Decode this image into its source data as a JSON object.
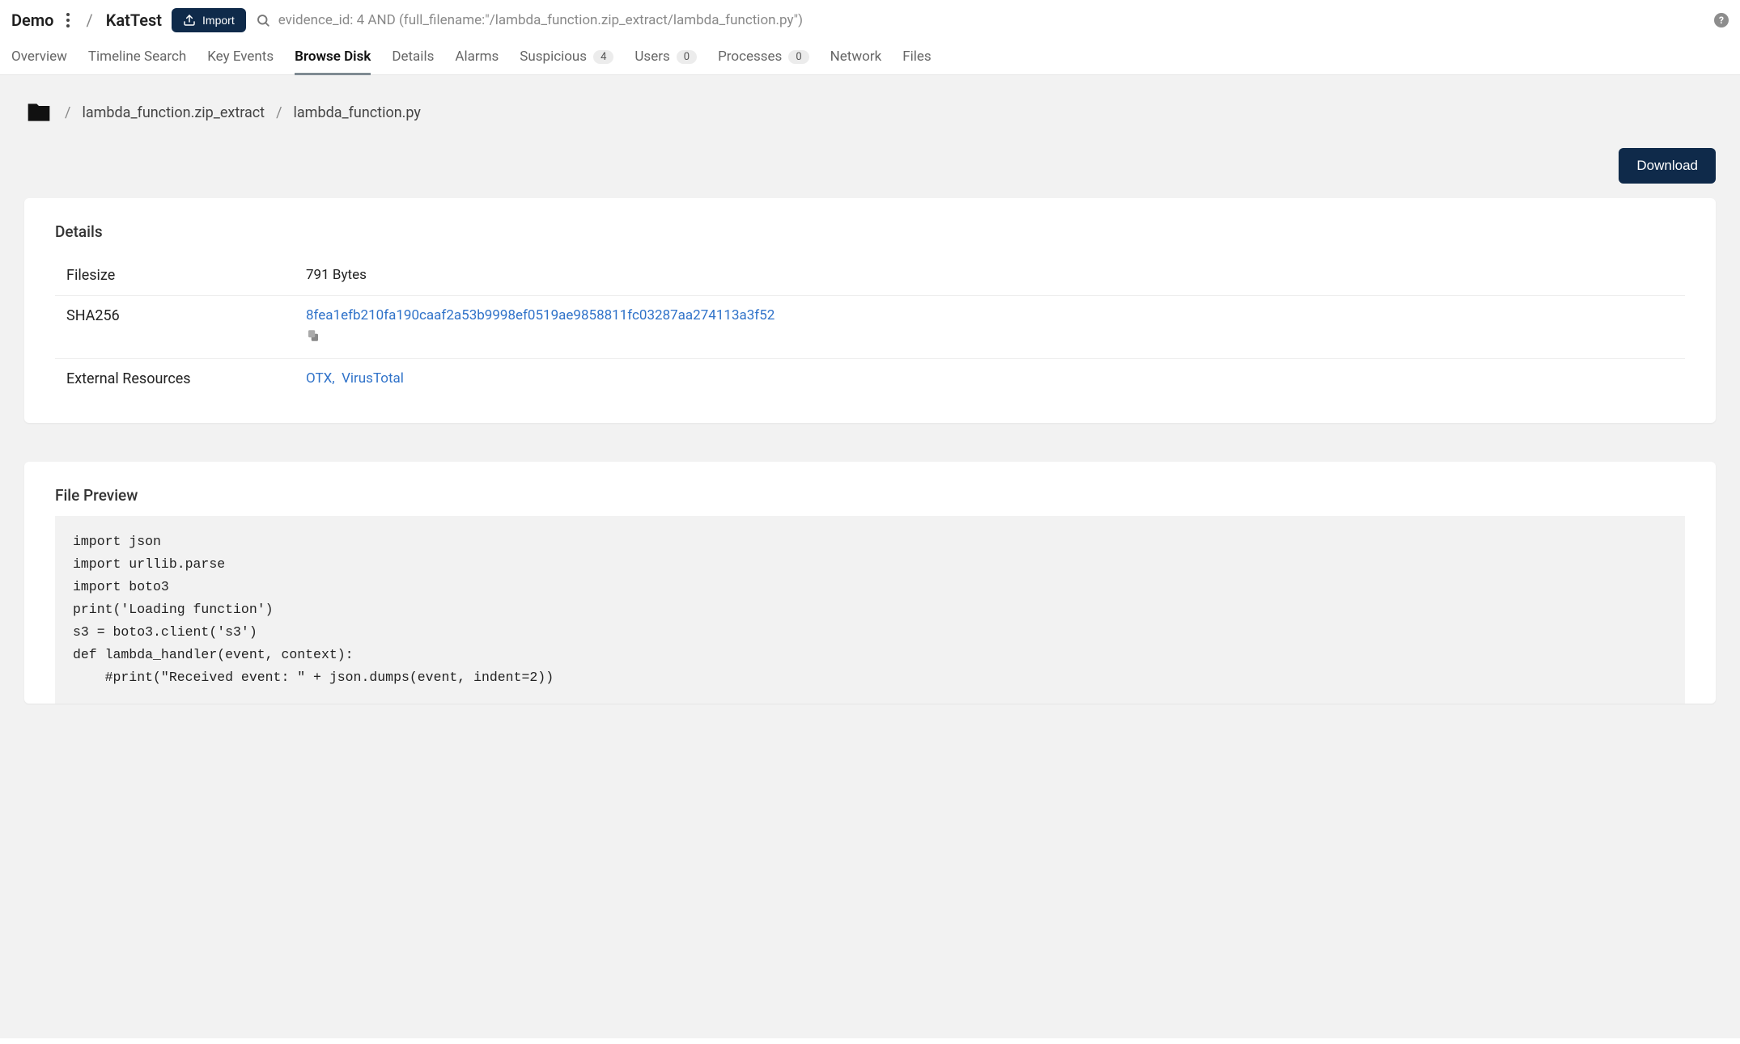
{
  "header": {
    "root": "Demo",
    "page": "KatTest",
    "import_label": "Import",
    "search_query": "evidence_id: 4 AND (full_filename:\"/lambda_function.zip_extract/lambda_function.py\")"
  },
  "tabs": {
    "overview": "Overview",
    "timeline": "Timeline Search",
    "keyevents": "Key Events",
    "browsedisk": "Browse Disk",
    "details": "Details",
    "alarms": "Alarms",
    "suspicious": "Suspicious",
    "suspicious_badge": "4",
    "users": "Users",
    "users_badge": "0",
    "processes": "Processes",
    "processes_badge": "0",
    "network": "Network",
    "files": "Files"
  },
  "breadcrumb": {
    "seg1": "lambda_function.zip_extract",
    "seg2": "lambda_function.py"
  },
  "actions": {
    "download": "Download"
  },
  "details_card": {
    "title": "Details",
    "filesize_label": "Filesize",
    "filesize_value": "791 Bytes",
    "sha_label": "SHA256",
    "sha_value": "8fea1efb210fa190caaf2a53b9998ef0519ae9858811fc03287aa274113a3f52",
    "ext_label": "External Resources",
    "ext_otx": "OTX",
    "ext_vt": "VirusTotal"
  },
  "preview": {
    "title": "File Preview",
    "code": "import json\nimport urllib.parse\nimport boto3\nprint('Loading function')\ns3 = boto3.client('s3')\ndef lambda_handler(event, context):\n    #print(\"Received event: \" + json.dumps(event, indent=2))"
  }
}
